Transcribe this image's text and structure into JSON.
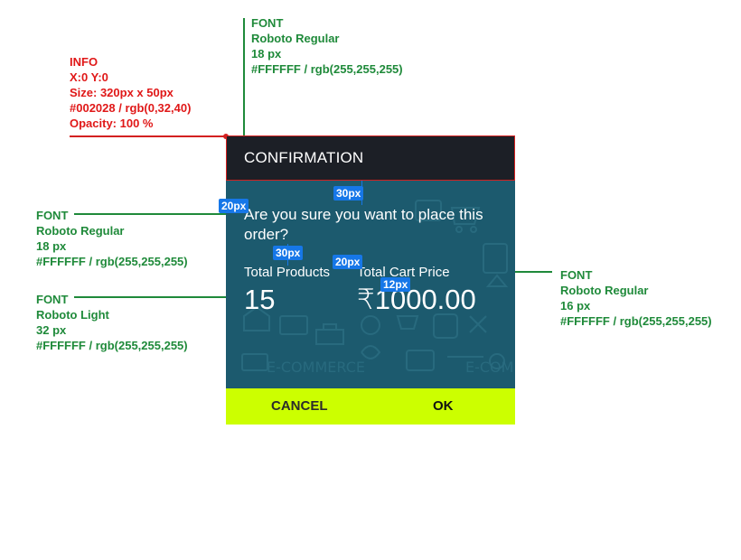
{
  "info_spec": {
    "title": "INFO",
    "pos": "X:0  Y:0",
    "size": "Size: 320px x 50px",
    "color": "#002028 / rgb(0,32,40)",
    "opacity": "Opacity: 100 %"
  },
  "header_font_spec": {
    "title": "FONT",
    "family": "Roboto Regular",
    "size": "18 px",
    "color": "#FFFFFF / rgb(255,255,255)"
  },
  "question_font_spec": {
    "title": "FONT",
    "family": "Roboto Regular",
    "size": "18 px",
    "color": "#FFFFFF / rgb(255,255,255)"
  },
  "value_font_spec": {
    "title": "FONT",
    "family": "Roboto Light",
    "size": "32 px",
    "color": "#FFFFFF / rgb(255,255,255)"
  },
  "label_font_spec": {
    "title": "FONT",
    "family": "Roboto Regular",
    "size": "16 px",
    "color": "#FFFFFF / rgb(255,255,255)"
  },
  "dialog": {
    "title": "CONFIRMATION",
    "question": "Are you sure you want to place this order?",
    "total_products_label": "Total Products",
    "total_price_label": "Total Cart Price",
    "total_products_value": "15",
    "total_price_value": "₹1000.00",
    "cancel_label": "CANCEL",
    "ok_label": "OK"
  },
  "spacing_badges": {
    "b1": "20px",
    "b2": "30px",
    "b3": "30px",
    "b4": "20px",
    "b5": "12px"
  },
  "colors": {
    "header_bg": "#1c1f26",
    "body_bg": "#1c5a6e",
    "footer_bg": "#ccff00",
    "spec_red": "#e01818",
    "spec_green": "#1f8a3a",
    "badge_blue": "#1677e8"
  }
}
